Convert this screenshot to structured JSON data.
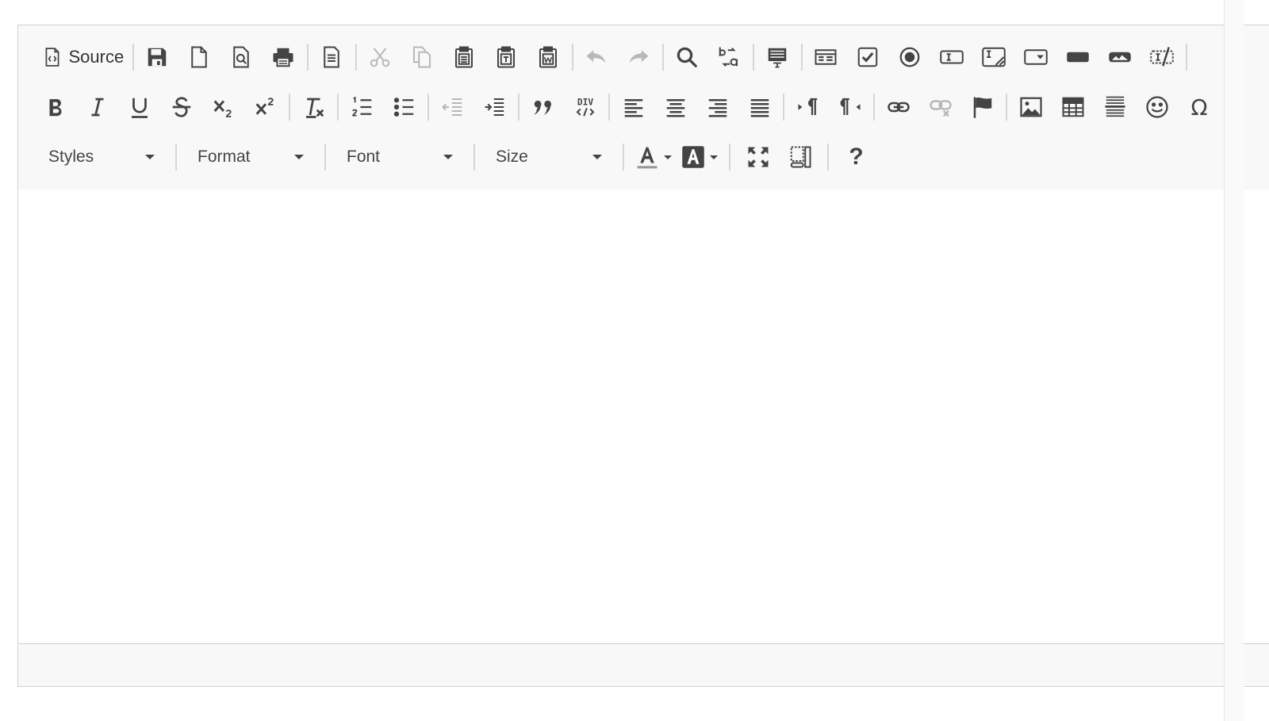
{
  "toolbar": {
    "source_label": "Source",
    "combos": {
      "styles": "Styles",
      "format": "Format",
      "font": "Font",
      "size": "Size"
    },
    "help_label": "?"
  },
  "icons": {
    "source": "source-icon",
    "save": "floppy-disk-icon",
    "new_page": "new-page-icon",
    "preview": "preview-icon",
    "print": "printer-icon",
    "templates": "templates-icon",
    "cut": "scissors-icon",
    "copy": "copy-icon",
    "paste": "paste-icon",
    "paste_text": "paste-text-icon",
    "paste_word": "paste-word-icon",
    "undo": "undo-icon",
    "redo": "redo-icon",
    "find": "magnifier-icon",
    "replace": "replace-icon",
    "select_all": "select-all-icon",
    "form": "form-icon",
    "checkbox": "checkbox-icon",
    "radio": "radio-icon",
    "textfield": "text-field-icon",
    "textarea": "textarea-icon",
    "select": "select-field-icon",
    "button": "button-icon",
    "image_button": "image-button-icon",
    "hidden_field": "hidden-field-icon"
  },
  "colors": {
    "toolbar_bg": "#f8f8f8",
    "border": "#d1d1d1",
    "icon": "#444444"
  }
}
